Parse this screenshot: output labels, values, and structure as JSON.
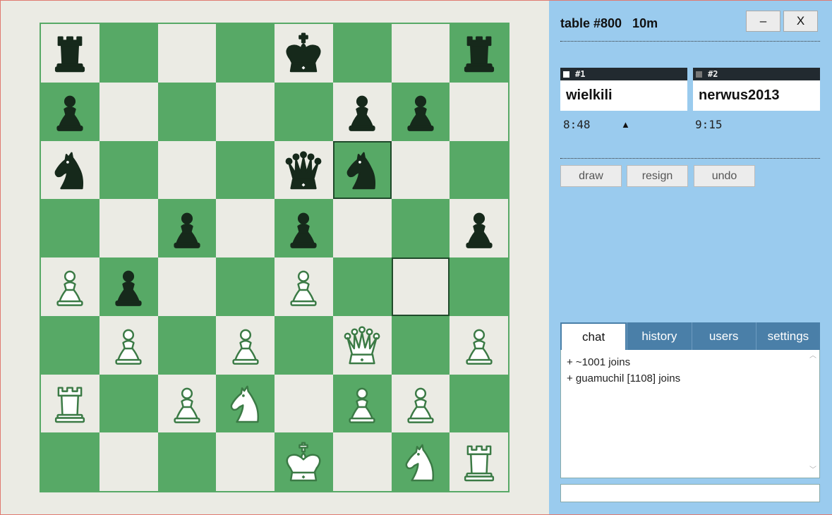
{
  "table": {
    "title": "table #800   10m"
  },
  "window": {
    "minimize_label": "–",
    "close_label": "X"
  },
  "players": [
    {
      "seat": "#1",
      "name": "wielkili",
      "clock": "8:48",
      "color": "white"
    },
    {
      "seat": "#2",
      "name": "nerwus2013",
      "clock": "9:15",
      "color": "black"
    }
  ],
  "turn_indicator": "▲",
  "actions": {
    "draw": "draw",
    "resign": "resign",
    "undo": "undo"
  },
  "tabs": [
    {
      "label": "chat",
      "active": true
    },
    {
      "label": "history",
      "active": false
    },
    {
      "label": "users",
      "active": false
    },
    {
      "label": "settings",
      "active": false
    }
  ],
  "chat": {
    "messages": [
      "+ ~1001 joins",
      "+ guamuchil [1108] joins"
    ],
    "input_value": ""
  },
  "colors": {
    "board_dark": "#57a966",
    "board_light": "#ebebe4",
    "panel_bg": "#9acbee",
    "tab_bg": "#4a7fa8",
    "black_piece": "#16291b",
    "white_piece_outline": "#3b7a45"
  },
  "board": {
    "ranks": [
      [
        "r",
        "",
        "",
        "",
        "k",
        "",
        "",
        "r"
      ],
      [
        "p",
        "",
        "",
        "",
        "",
        "p",
        "p",
        ""
      ],
      [
        "n",
        "",
        "",
        "",
        "q",
        "n",
        "",
        ""
      ],
      [
        "",
        "",
        "p",
        "",
        "p",
        "",
        "",
        "p"
      ],
      [
        "P",
        "p",
        "",
        "",
        "P",
        "",
        "",
        ""
      ],
      [
        "",
        "P",
        "",
        "P",
        "",
        "Q",
        "",
        "P"
      ],
      [
        "R",
        "",
        "P",
        "N",
        "",
        "P",
        "P",
        ""
      ],
      [
        "",
        "",
        "",
        "",
        "K",
        "",
        "N",
        "R"
      ]
    ],
    "highlighted": [
      "f6",
      "g4"
    ]
  }
}
